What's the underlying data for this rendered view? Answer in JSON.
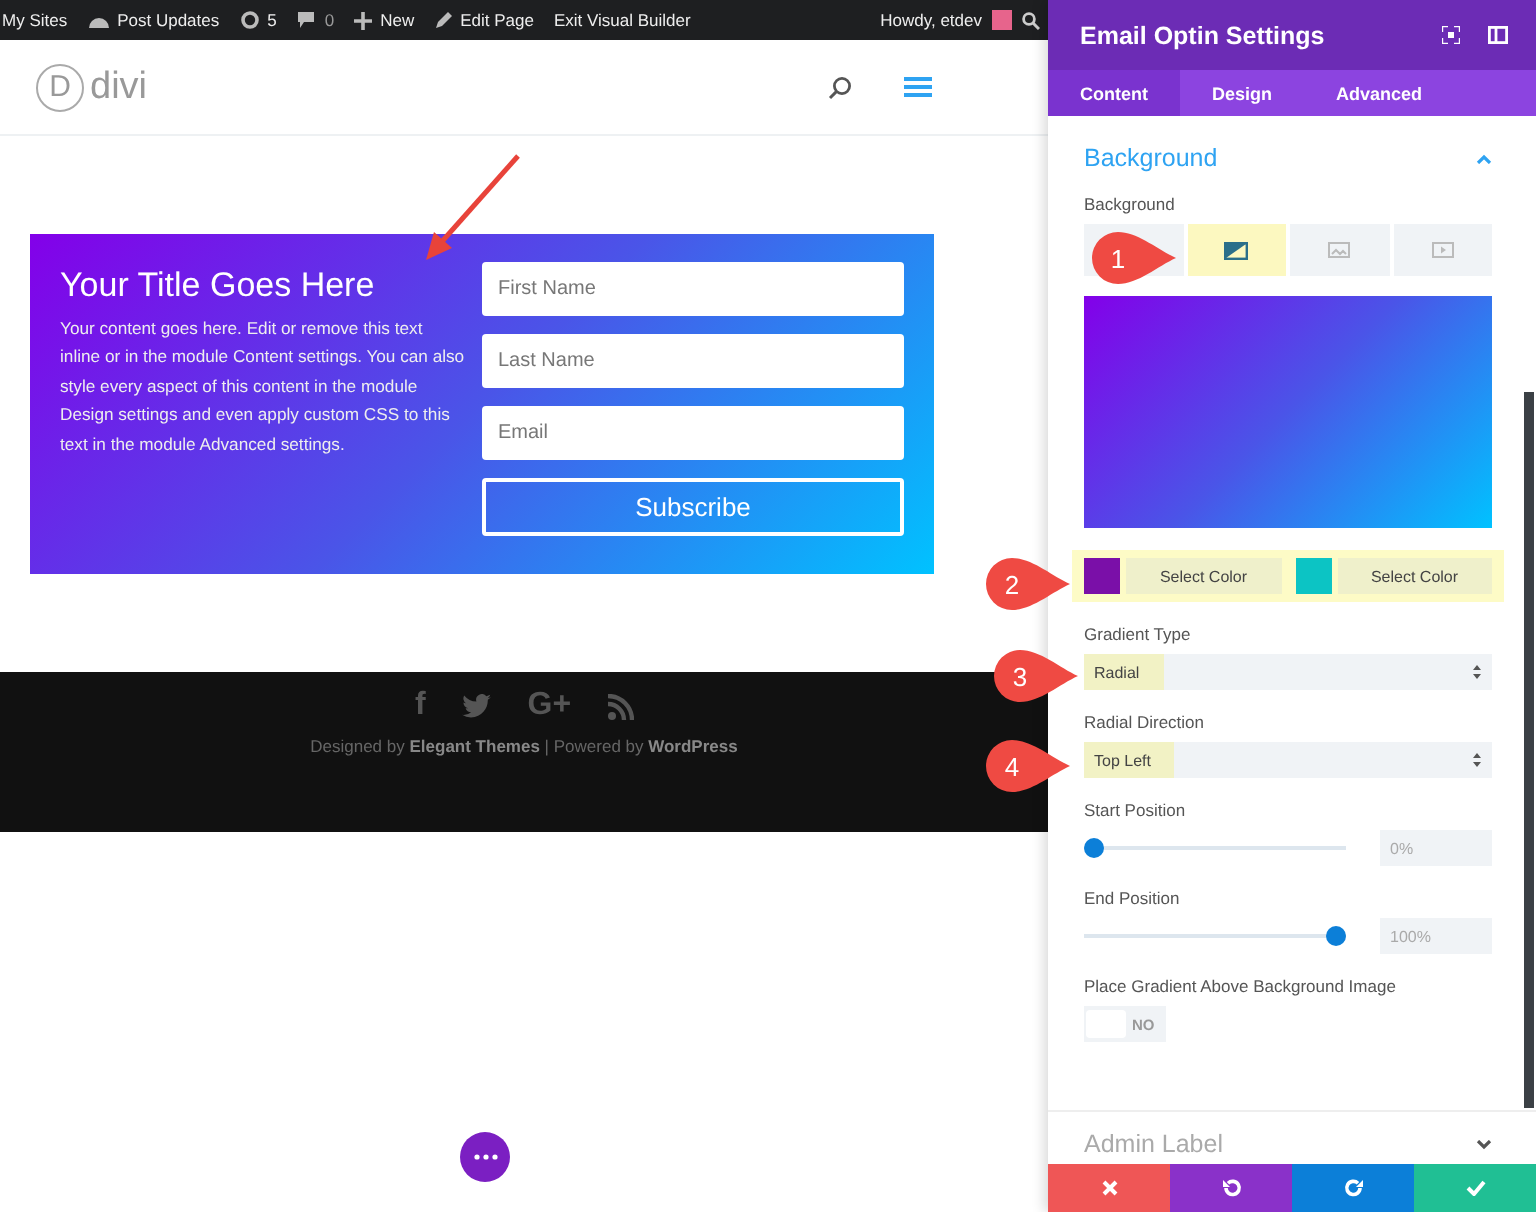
{
  "admin_bar": {
    "items": [
      {
        "kind": "text",
        "label": "My Sites"
      },
      {
        "kind": "dashboard",
        "label": "Post Updates"
      },
      {
        "kind": "updates",
        "label": "5"
      },
      {
        "kind": "comments",
        "label": "0"
      },
      {
        "kind": "new",
        "label": "New"
      },
      {
        "kind": "edit",
        "label": "Edit Page"
      },
      {
        "kind": "text",
        "label": "Exit Visual Builder"
      }
    ],
    "greeting": "Howdy, etdev"
  },
  "header": {
    "logo_letter": "D",
    "logo_text": "divi"
  },
  "optin": {
    "title": "Your Title Goes Here",
    "body": "Your content goes here. Edit or remove this text inline or in the module Content settings. You can also style every aspect of this content in the module Design settings and even apply custom CSS to this text in the module Advanced settings.",
    "fields": [
      {
        "placeholder": "First Name"
      },
      {
        "placeholder": "Last Name"
      },
      {
        "placeholder": "Email"
      }
    ],
    "button": "Subscribe"
  },
  "footer": {
    "social": [
      {
        "kind": "glyph",
        "label": "f"
      },
      {
        "kind": "twitter"
      },
      {
        "kind": "glyph",
        "label": "G+"
      },
      {
        "kind": "rss"
      }
    ],
    "credits": "Designed by **Elegant Themes** | Powered by **WordPress**"
  },
  "annotations": [
    {
      "label": "1"
    },
    {
      "label": "2"
    },
    {
      "label": "3"
    },
    {
      "label": "4"
    }
  ],
  "panel": {
    "title": "Email Optin Settings",
    "tabs": [
      {
        "label": "Content",
        "selected": true
      },
      {
        "label": "Design",
        "selected": false
      },
      {
        "label": "Advanced",
        "selected": false
      }
    ],
    "section": {
      "title": "Background",
      "expanded": true
    },
    "background_label": "Background",
    "background_types": [
      {
        "kind": "color",
        "selected": false
      },
      {
        "kind": "gradient",
        "selected": true
      },
      {
        "kind": "image",
        "selected": false
      },
      {
        "kind": "video",
        "selected": false
      }
    ],
    "colors_highlighted": true,
    "colors": [
      {
        "color": "#7a0fa8",
        "label": "Select Color"
      },
      {
        "color": "#0cc4c4",
        "label": "Select Color"
      }
    ],
    "selects": [
      {
        "label": "Gradient Type",
        "value": "Radial",
        "highlighted": true
      },
      {
        "label": "Radial Direction",
        "value": "Top Left",
        "highlighted": true
      }
    ],
    "sliders": [
      {
        "label": "Start Position",
        "level": 0,
        "reading": "0%"
      },
      {
        "label": "End Position",
        "level": 1,
        "reading": "100%"
      }
    ],
    "toggle": {
      "label": "Place Gradient Above Background Image",
      "on": false,
      "text": "NO"
    },
    "collapsed_section": {
      "title": "Admin Label",
      "expanded": false
    },
    "actions": [
      {
        "kind": "close"
      },
      {
        "kind": "undo"
      },
      {
        "kind": "redo"
      },
      {
        "kind": "save"
      }
    ]
  }
}
